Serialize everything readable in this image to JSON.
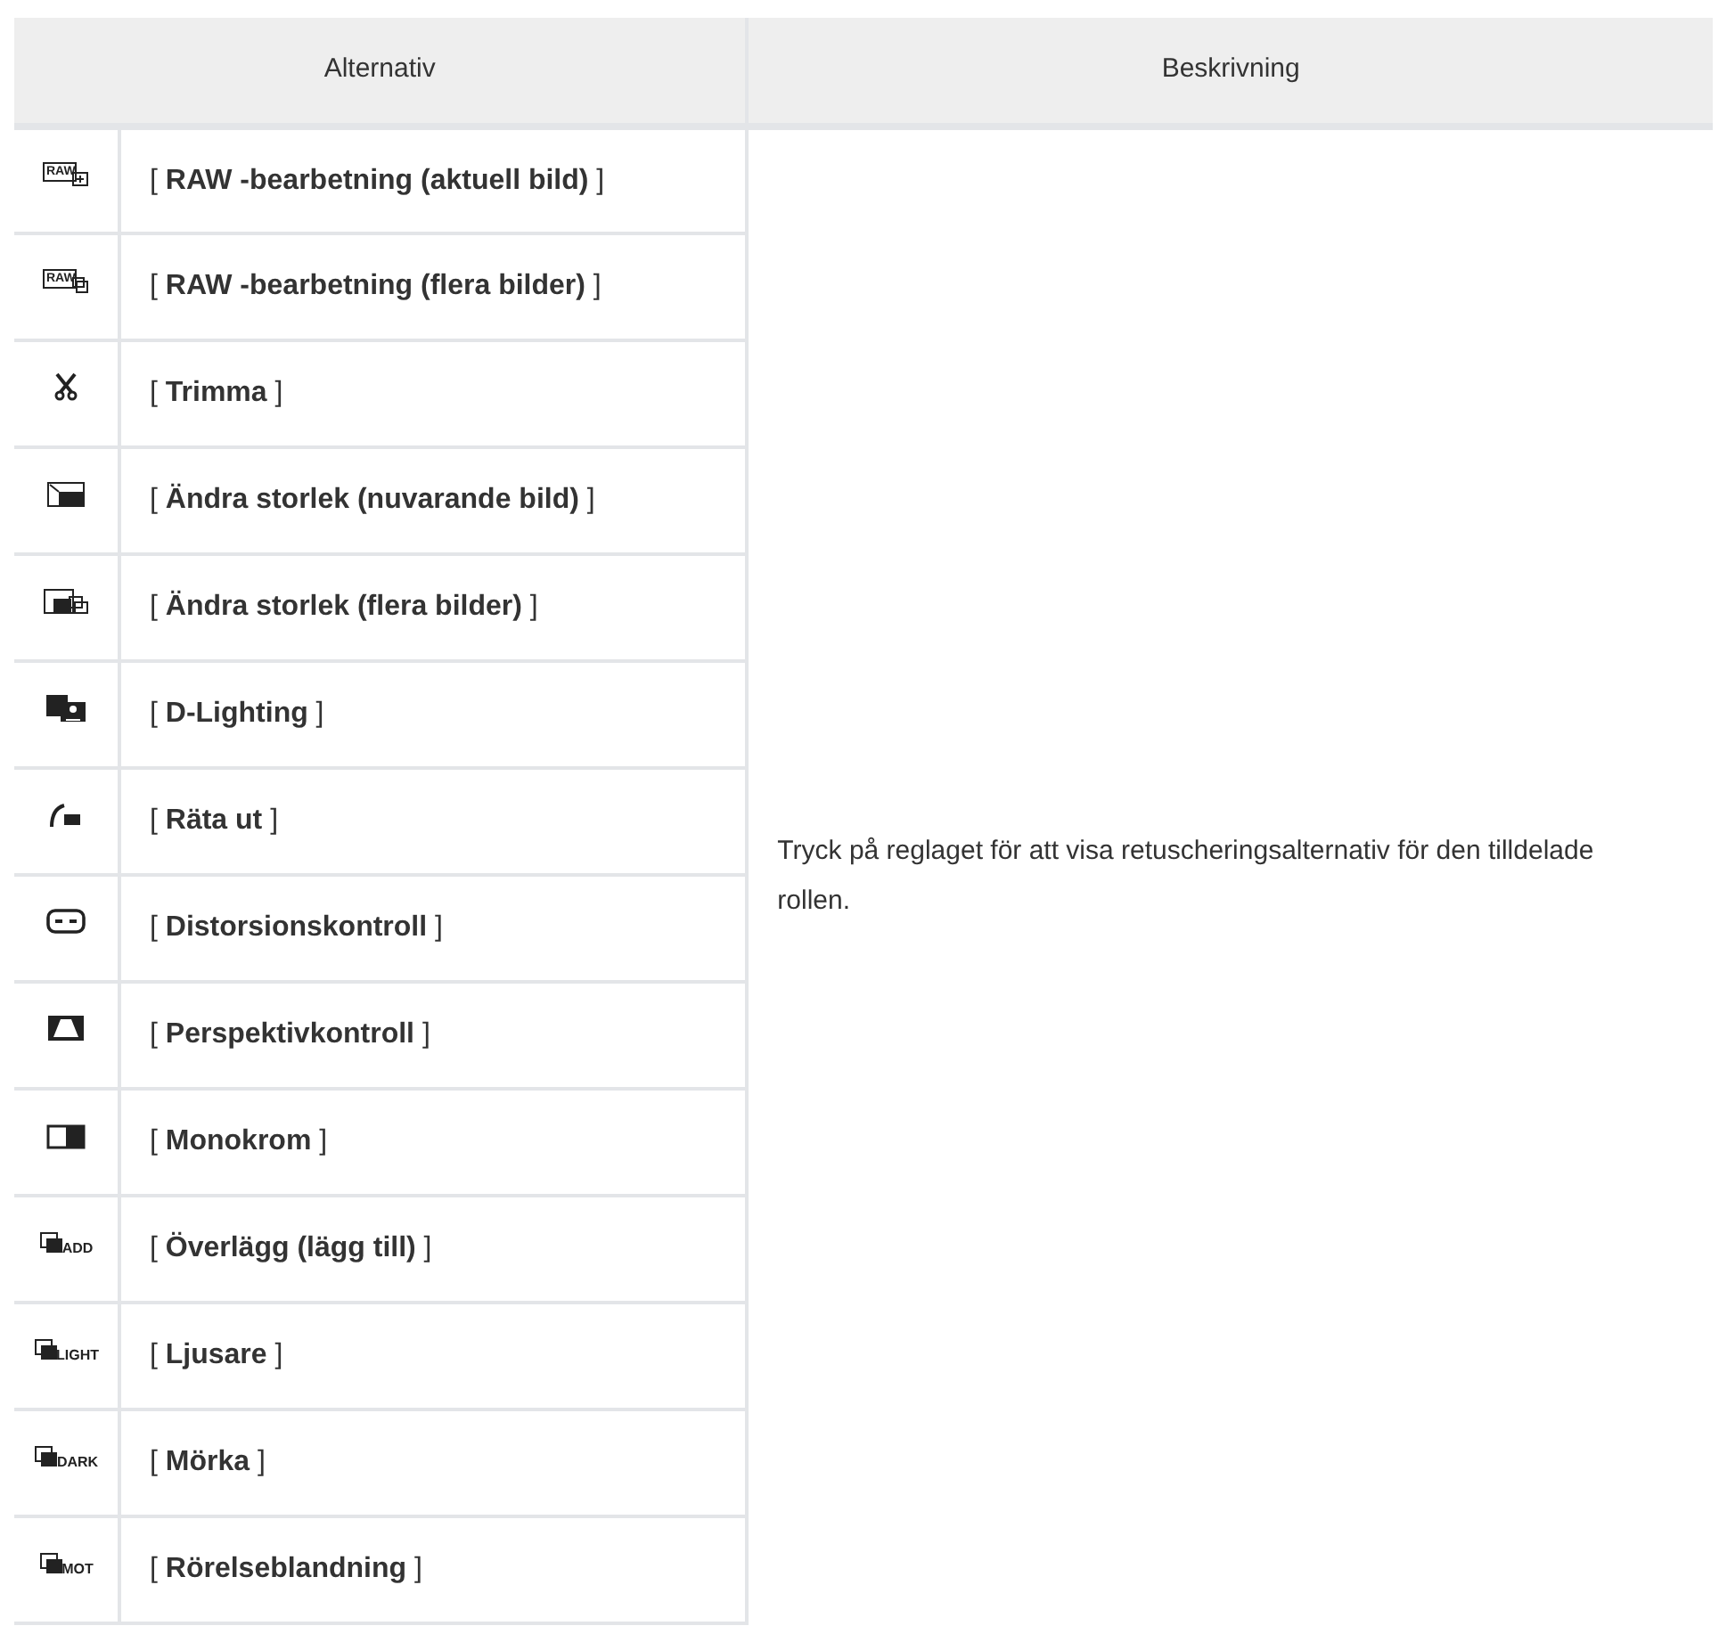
{
  "table": {
    "columns": [
      "Alternativ",
      "Beskrivning"
    ],
    "rows": [
      {
        "kind": "raw",
        "icon_text": "RAW",
        "label": "[ **RAW -bearbetning (aktuell bild)** ]"
      },
      {
        "kind": "raw-multi",
        "icon_text": "RAW",
        "label": "[ **RAW -bearbetning (flera bilder)** ]"
      },
      {
        "kind": "scissors",
        "label": "[ **Trimma** ]"
      },
      {
        "kind": "resize",
        "label": "[ **Ändra storlek (nuvarande bild)** ]"
      },
      {
        "kind": "resize-multi",
        "label": "[ **Ändra storlek (flera bilder)** ]"
      },
      {
        "kind": "d-lighting",
        "label": "[ **D-Lighting** ]"
      },
      {
        "kind": "straighten",
        "label": "[ **Räta ut** ]"
      },
      {
        "kind": "distortion",
        "label": "[ **Distorsionskontroll** ]"
      },
      {
        "kind": "perspective",
        "label": "[ **Perspektivkontroll** ]"
      },
      {
        "kind": "monochrome",
        "label": "[ **Monokrom** ]"
      },
      {
        "kind": "overlay",
        "icon_text": "ADD",
        "label": "[ **Överlägg (lägg till)** ]"
      },
      {
        "kind": "overlay",
        "icon_text": "LIGHT",
        "label": "[ **Ljusare** ]"
      },
      {
        "kind": "overlay",
        "icon_text": "DARK",
        "label": "[ **Mörka** ]"
      },
      {
        "kind": "overlay",
        "icon_text": "MOT",
        "label": "[ **Rörelseblandning** ]"
      }
    ],
    "description": "Tryck på reglaget för att visa retuscheringsalternativ för den tilldelade rollen."
  }
}
